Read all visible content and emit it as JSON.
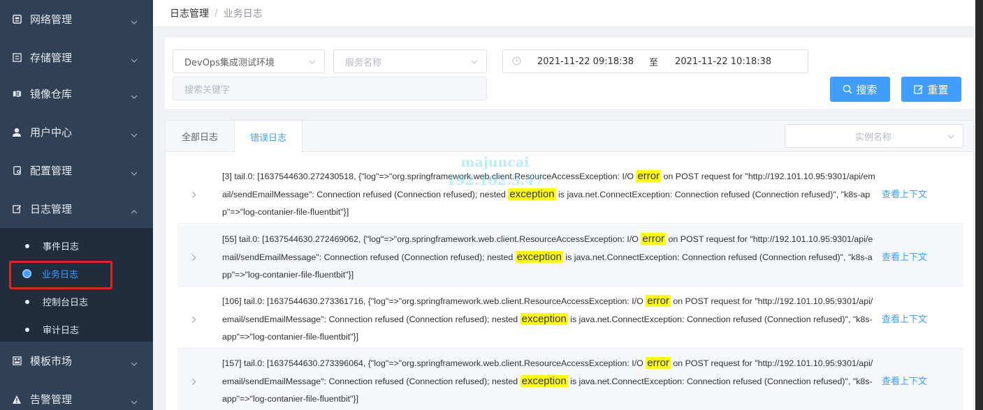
{
  "sidebar": {
    "items": [
      {
        "label": "网络管理",
        "icon": "server-icon"
      },
      {
        "label": "存储管理",
        "icon": "storage-icon"
      },
      {
        "label": "镜像仓库",
        "icon": "image-repo-icon"
      },
      {
        "label": "用户中心",
        "icon": "user-icon"
      },
      {
        "label": "配置管理",
        "icon": "config-icon"
      },
      {
        "label": "日志管理",
        "icon": "edit-icon"
      },
      {
        "label": "模板市场",
        "icon": "template-icon"
      },
      {
        "label": "告警管理",
        "icon": "alert-icon"
      }
    ],
    "log_sub": [
      "事件日志",
      "业务日志",
      "控制台日志",
      "审计日志"
    ],
    "active_sub": "业务日志"
  },
  "breadcrumb": {
    "parent": "日志管理",
    "separator": "/",
    "current": "业务日志"
  },
  "filters": {
    "env_value": "DevOps集成测试环境",
    "service_placeholder": "服务名称",
    "date_start": "2021-11-22 09:18:38",
    "date_to": "至",
    "date_end": "2021-11-22 10:18:38",
    "keyword_placeholder": "搜索关键字",
    "search_label": "搜索",
    "reset_label": "重置"
  },
  "tabs": {
    "all": "全部日志",
    "error": "错误日志",
    "active": "错误日志"
  },
  "instance_placeholder": "实例名称",
  "context_label": "查看上下文",
  "watermark": {
    "line1": "majuncai",
    "line2": "192.102.3.47"
  },
  "logs": [
    {
      "p1": "[3] tail.0: [1637544630.272430518, {\"log\"=>\"org.springframework.web.client.ResourceAccessException: I/O ",
      "h1": "error",
      "p2": " on POST request for \"http://192.101.10.95:9301/api/email/sendEmailMessage\": Connection refused (Connection refused); nested ",
      "h2": "exception",
      "p3": " is java.net.ConnectException: Connection refused (Connection refused)\", \"k8s-app\"=>\"log-contanier-file-fluentbit\"}]"
    },
    {
      "p1": "[55] tail.0: [1637544630.272469062, {\"log\"=>\"org.springframework.web.client.ResourceAccessException: I/O ",
      "h1": "error",
      "p2": " on POST request for \"http://192.101.10.95:9301/api/email/sendEmailMessage\": Connection refused (Connection refused); nested ",
      "h2": "exception",
      "p3": " is java.net.ConnectException: Connection refused (Connection refused)\", \"k8s-app\"=>\"log-contanier-file-fluentbit\"}]"
    },
    {
      "p1": "[106] tail.0: [1637544630.273361716, {\"log\"=>\"org.springframework.web.client.ResourceAccessException: I/O ",
      "h1": "error",
      "p2": " on POST request for \"http://192.101.10.95:9301/api/email/sendEmailMessage\": Connection refused (Connection refused); nested ",
      "h2": "exception",
      "p3": " is java.net.ConnectException: Connection refused (Connection refused)\", \"k8s-app\"=>\"log-contanier-file-fluentbit\"}]"
    },
    {
      "p1": "[157] tail.0: [1637544630.273396064, {\"log\"=>\"org.springframework.web.client.ResourceAccessException: I/O ",
      "h1": "error",
      "p2": " on POST request for \"http://192.101.10.95:9301/api/email/sendEmailMessage\": Connection refused (Connection refused); nested ",
      "h2": "exception",
      "p3": " is java.net.ConnectException: Connection refused (Connection refused)\", \"k8s-app\"=>\"log-contanier-file-fluentbit\"}]"
    }
  ]
}
